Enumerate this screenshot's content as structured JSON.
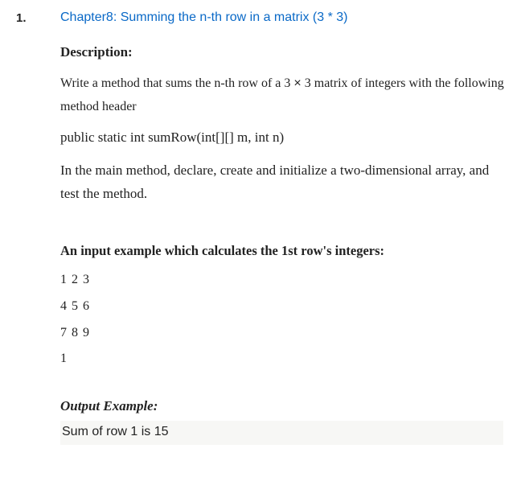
{
  "question_number": "1.",
  "title": "Chapter8: Summing the n-th row in a matrix (3 * 3)",
  "description_heading": "Description:",
  "description_line1_a": "Write a method that sums the n-th row of a 3 ",
  "description_line1_times": "×",
  "description_line1_b": "  3 matrix of integers with the following method header",
  "method_signature": "public static int sumRow(int[][] m, int n)",
  "description_line2": "In the main method, declare, create and initialize a two-dimensional array, and test the method.",
  "input_heading": "An input example which calculates the 1st row's integers:",
  "input_rows": [
    "1 2 3",
    "4 5 6",
    "7 8 9",
    "1"
  ],
  "output_heading": "Output Example:",
  "output_line": "Sum of row 1 is 15"
}
